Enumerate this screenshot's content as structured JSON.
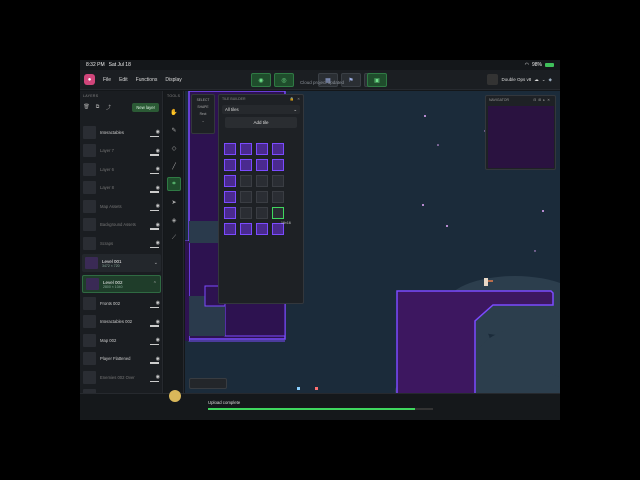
{
  "status_bar": {
    "time": "8:32 PM",
    "date": "Sat Jul 18",
    "battery": "98%"
  },
  "menubar": {
    "items": [
      "File",
      "Edit",
      "Functions",
      "Display"
    ]
  },
  "toolbar_left": [
    {
      "icon": "eye-icon",
      "label": "Layers",
      "active": true
    },
    {
      "icon": "compass-icon",
      "label": "Navigator",
      "active": true
    }
  ],
  "toolbar_mid": [
    {
      "icon": "grid-icon",
      "label": "",
      "active": false
    },
    {
      "icon": "flag-icon",
      "label": "",
      "active": false
    },
    {
      "icon": "stack-icon",
      "label": "",
      "active": false
    }
  ],
  "toolbar_right": [
    {
      "icon": "tile-icon",
      "label": "Tile Builder",
      "active": true
    }
  ],
  "toast": "Cloud project updated",
  "project": {
    "name": "Double Ops v8"
  },
  "layers_panel": {
    "title": "LAYERS",
    "new_layer": "New layer",
    "rows_top": [
      {
        "label": "Interactables",
        "dim": false,
        "visible": true
      },
      {
        "label": "Layer 7",
        "dim": true,
        "visible": true
      },
      {
        "label": "Layer 6",
        "dim": true,
        "visible": true
      },
      {
        "label": "Layer 8",
        "dim": true,
        "visible": true
      },
      {
        "label": "Map Assets",
        "dim": true,
        "visible": true
      },
      {
        "label": "Background Assets",
        "dim": true,
        "visible": true
      },
      {
        "label": "Scraps",
        "dim": true,
        "visible": true
      }
    ],
    "levels": [
      {
        "name": "Level 001",
        "size": "3472 × 720",
        "active": false
      },
      {
        "name": "Level 002",
        "size": "2800 × 1040",
        "active": true
      }
    ],
    "rows_bottom": [
      {
        "label": "Fronts 002",
        "dim": false,
        "visible": true
      },
      {
        "label": "Interactables 002",
        "dim": false,
        "visible": true
      },
      {
        "label": "Map 002",
        "dim": false,
        "visible": true
      },
      {
        "label": "Player Flattened",
        "dim": false,
        "visible": true
      },
      {
        "label": "Enemies 002 Over",
        "dim": true,
        "visible": true
      },
      {
        "label": "Enemies 002",
        "dim": true,
        "visible": true
      }
    ]
  },
  "tools_panel": {
    "title": "TOOLS"
  },
  "select_panel": {
    "title": "SELECT",
    "shape_label": "SHAPE",
    "shape_value": "Rect"
  },
  "tile_builder": {
    "title": "TILE BUILDER",
    "filter": "All tiles",
    "add_tile": "Add tile",
    "tile_size": "16×16"
  },
  "navigator": {
    "title": "NAVIGATOR"
  },
  "upload": {
    "status": "Upload complete",
    "progress": 0.92
  },
  "colors": {
    "accent_green": "#3fd65e",
    "level_purple": "#3d1760",
    "level_edge": "#7b4bff",
    "sky": "#1b2b3a"
  }
}
